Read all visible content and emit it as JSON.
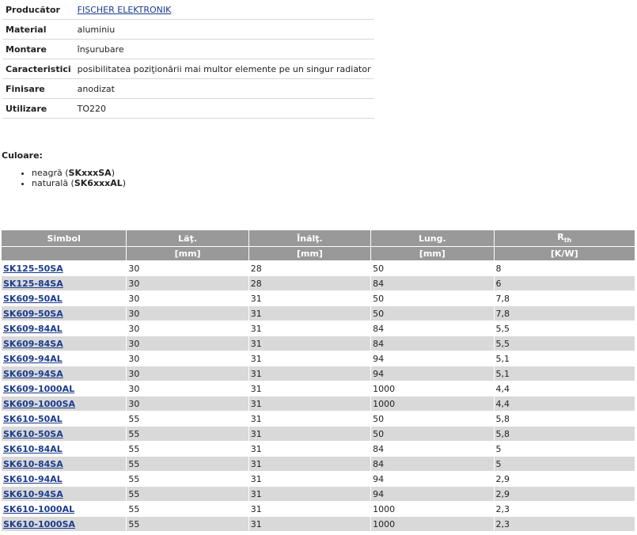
{
  "attributes": [
    {
      "label": "Producător",
      "value": "FISCHER ELEKTRONIK",
      "link": true
    },
    {
      "label": "Material",
      "value": "aluminiu"
    },
    {
      "label": "Montare",
      "value": "înşurubare"
    },
    {
      "label": "Caracteristici",
      "value": "posibilitatea poziţionării mai multor elemente pe un singur radiator"
    },
    {
      "label": "Finisare",
      "value": "anodizat"
    },
    {
      "label": "Utilizare",
      "value": "TO220"
    }
  ],
  "colors": {
    "heading": "Culoare:",
    "items": [
      {
        "name": "neagră",
        "code": "SKxxxSA"
      },
      {
        "name": "naturală",
        "code": "SK6xxxAL"
      }
    ]
  },
  "table": {
    "headers": [
      "Simbol",
      "Lăţ.",
      "Înălţ.",
      "Lung.",
      "R"
    ],
    "rth_sub": "th",
    "units": [
      "",
      "[mm]",
      "[mm]",
      "[mm]",
      "[K/W]"
    ],
    "rows": [
      [
        "SK125-50SA",
        "30",
        "28",
        "50",
        "8"
      ],
      [
        "SK125-84SA",
        "30",
        "28",
        "84",
        "6"
      ],
      [
        "SK609-50AL",
        "30",
        "31",
        "50",
        "7,8"
      ],
      [
        "SK609-50SA",
        "30",
        "31",
        "50",
        "7,8"
      ],
      [
        "SK609-84AL",
        "30",
        "31",
        "84",
        "5,5"
      ],
      [
        "SK609-84SA",
        "30",
        "31",
        "84",
        "5,5"
      ],
      [
        "SK609-94AL",
        "30",
        "31",
        "94",
        "5,1"
      ],
      [
        "SK609-94SA",
        "30",
        "31",
        "94",
        "5,1"
      ],
      [
        "SK609-1000AL",
        "30",
        "31",
        "1000",
        "4,4"
      ],
      [
        "SK609-1000SA",
        "30",
        "31",
        "1000",
        "4,4"
      ],
      [
        "SK610-50AL",
        "55",
        "31",
        "50",
        "5,8"
      ],
      [
        "SK610-50SA",
        "55",
        "31",
        "50",
        "5,8"
      ],
      [
        "SK610-84AL",
        "55",
        "31",
        "84",
        "5"
      ],
      [
        "SK610-84SA",
        "55",
        "31",
        "84",
        "5"
      ],
      [
        "SK610-94AL",
        "55",
        "31",
        "94",
        "2,9"
      ],
      [
        "SK610-94SA",
        "55",
        "31",
        "94",
        "2,9"
      ],
      [
        "SK610-1000AL",
        "55",
        "31",
        "1000",
        "2,3"
      ],
      [
        "SK610-1000SA",
        "55",
        "31",
        "1000",
        "2,3"
      ]
    ]
  },
  "theme": {
    "header_bg": "#999999",
    "row_alt": "#d9d9d9",
    "link": "#1a3b8c"
  }
}
